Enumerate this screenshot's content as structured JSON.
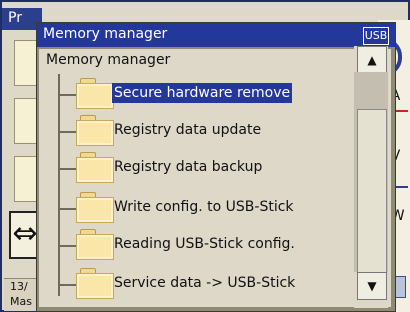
{
  "background": {
    "title_partial": "Pr",
    "status_lines": [
      "13/",
      "Mas"
    ],
    "right_labels": [
      "/A",
      "/V",
      "/W"
    ]
  },
  "dialog": {
    "title": "Memory manager",
    "badge": "USB",
    "header": "Memory manager",
    "items": [
      {
        "label": "Secure hardware remove",
        "selected": true,
        "icon": "folder-icon"
      },
      {
        "label": "Registry data update",
        "selected": false,
        "icon": "folder-icon"
      },
      {
        "label": "Registry data backup",
        "selected": false,
        "icon": "folder-icon"
      },
      {
        "label": "Write config. to USB-Stick",
        "selected": false,
        "icon": "folder-icon"
      },
      {
        "label": "Reading USB-Stick config.",
        "selected": false,
        "icon": "folder-icon"
      },
      {
        "label": "Service data -> USB-Stick",
        "selected": false,
        "icon": "folder-icon"
      }
    ],
    "scroll_up_icon": "up-arrow-icon",
    "scroll_down_icon": "down-arrow-icon"
  },
  "colors": {
    "titlebar": "#24379a",
    "selection": "#24379a",
    "folder": "#f9e6a8"
  }
}
